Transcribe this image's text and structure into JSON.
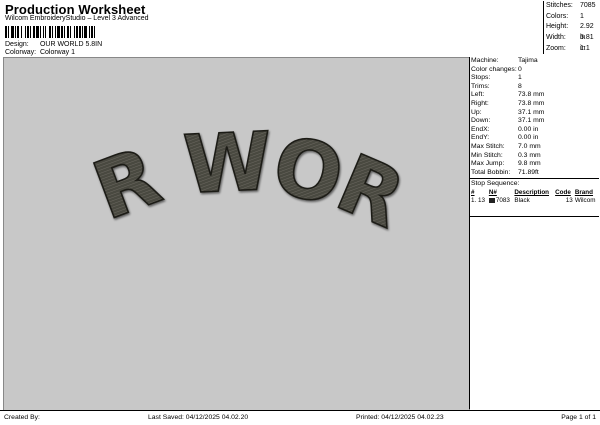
{
  "header": {
    "title": "Production Worksheet",
    "subtitle": "Wilcom EmbroideryStudio – Level 3 Advanced",
    "design_label": "Design:",
    "design_value": "OUR WORLD 5.8IN",
    "colorway_label": "Colorway:",
    "colorway_value": "Colorway 1"
  },
  "stats": [
    {
      "k": "Stitches:",
      "v": "7085"
    },
    {
      "k": "Colors:",
      "v": "1"
    },
    {
      "k": "Height:",
      "v": "2.92 in"
    },
    {
      "k": "Width:",
      "v": "5.81 in"
    },
    {
      "k": "Zoom:",
      "v": "1:1"
    }
  ],
  "design_text": "OUR WORLD",
  "colors": {
    "thread": "#4a4841",
    "thread_light": "#6b6960",
    "canvas": "#c8c8c8"
  },
  "panel": {
    "rows": [
      {
        "k": "Machine:",
        "v": "Tajima"
      },
      {
        "k": "Color changes:",
        "v": "0"
      },
      {
        "k": "Stops:",
        "v": "1"
      },
      {
        "k": "Trims:",
        "v": "8"
      },
      {
        "k": "Left:",
        "v": "73.8 mm"
      },
      {
        "k": "Right:",
        "v": "73.8 mm"
      },
      {
        "k": "Up:",
        "v": "37.1 mm"
      },
      {
        "k": "Down:",
        "v": "37.1 mm"
      },
      {
        "k": "EndX:",
        "v": "0.00 in"
      },
      {
        "k": "EndY:",
        "v": "0.00 in"
      },
      {
        "k": "Max Stitch:",
        "v": "7.0 mm"
      },
      {
        "k": "Min Stitch:",
        "v": "0.3 mm"
      },
      {
        "k": "Max Jump:",
        "v": "9.8 mm"
      },
      {
        "k": "Total Bobbin:",
        "v": "71.89ft"
      }
    ],
    "stop_sequence_title": "Stop Sequence:",
    "stop_headers": [
      "#",
      "N#",
      "Description",
      "Code",
      "Brand"
    ],
    "stops": [
      {
        "num": "1.",
        "n": "13",
        "count": "7083",
        "desc": "Black",
        "code": "13",
        "brand": "Wilcom"
      }
    ]
  },
  "footer": {
    "created": "Created By:",
    "saved": "Last Saved: 04/12/2025 04.02.20",
    "printed": "Printed: 04/12/2025 04.02.23",
    "page": "Page 1 of 1"
  }
}
